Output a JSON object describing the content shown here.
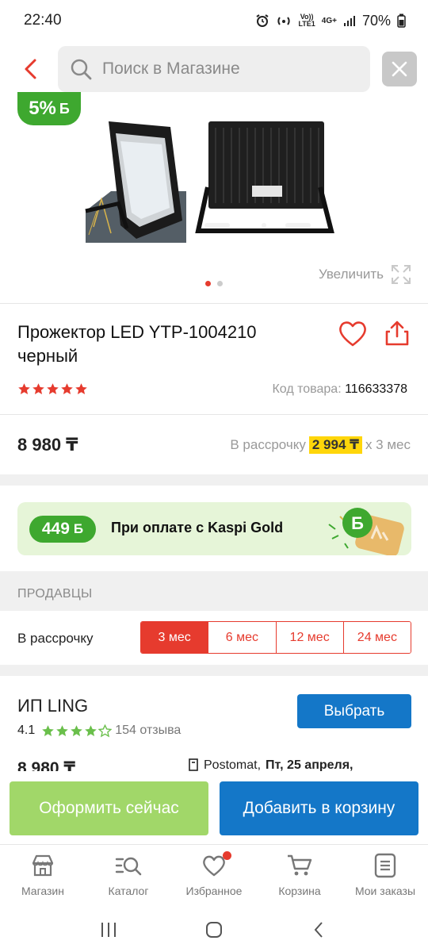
{
  "status": {
    "time": "22:40",
    "net_line1": "Vo))",
    "net_line2": "LTE1",
    "signal": "4G+",
    "battery": "70%"
  },
  "search": {
    "placeholder": "Поиск в Магазине"
  },
  "gallery": {
    "badge_pct": "5%",
    "badge_unit": "Б",
    "zoom_label": "Увеличить",
    "dots_count": 2,
    "active_dot": 0
  },
  "product": {
    "title": "Прожектор LED YTP-1004210 черный",
    "rating": 5,
    "sku_label": "Код товара:",
    "sku_value": "116633378",
    "price": "8 980 ₸",
    "installment_label": "В рассрочку",
    "installment_amount": "2 994 ₸",
    "installment_term": "х 3 мес"
  },
  "kaspi": {
    "bonus": "449",
    "bonus_unit": "Б",
    "text": "При оплате с Kaspi Gold"
  },
  "sellers": {
    "heading": "ПРОДАВЦЫ",
    "installment_row_label": "В рассрочку",
    "tabs": [
      "3 мес",
      "6 мес",
      "12 мес",
      "24 мес"
    ],
    "active_tab": 0,
    "seller": {
      "name": "ИП LING",
      "rating": "4.1",
      "rating_value": 4.1,
      "reviews": "154 отзыва",
      "choose_label": "Выбрать",
      "price": "8 980 ₸",
      "delivery_method": "Postomat,",
      "delivery_date": "Пт, 25 апреля,"
    }
  },
  "actions": {
    "checkout": "Оформить сейчас",
    "add_to_cart": "Добавить в корзину"
  },
  "bottom_nav": [
    "Магазин",
    "Каталог",
    "Избранное",
    "Корзина",
    "Мои заказы"
  ],
  "colors": {
    "accent_red": "#e63b2e",
    "kaspi_green": "#3ea82f",
    "primary_blue": "#1477c8",
    "checkout_green": "#a1d769",
    "installment_yellow": "#ffd60a"
  }
}
